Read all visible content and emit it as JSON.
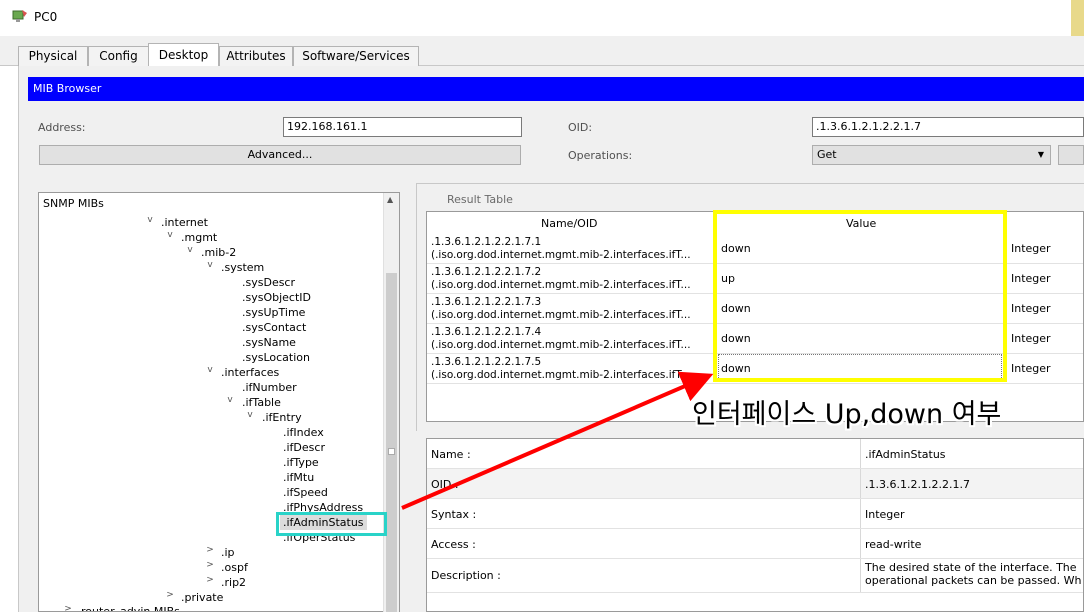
{
  "window": {
    "title": "PC0"
  },
  "tabs": [
    "Physical",
    "Config",
    "Desktop",
    "Attributes",
    "Software/Services"
  ],
  "mib_browser": {
    "title": "MIB Browser",
    "address_label": "Address:",
    "address_value": "192.168.161.1",
    "oid_label": "OID:",
    "oid_value": ".1.3.6.1.2.1.2.2.1.7",
    "advanced_label": "Advanced...",
    "operations_label": "Operations:",
    "operation_value": "Get"
  },
  "tree": {
    "root": "SNMP MIBs",
    "nodes": [
      ".internet",
      ".mgmt",
      ".mib-2",
      ".system",
      ".sysDescr",
      ".sysObjectID",
      ".sysUpTime",
      ".sysContact",
      ".sysName",
      ".sysLocation",
      ".interfaces",
      ".ifNumber",
      ".ifTable",
      ".ifEntry",
      ".ifIndex",
      ".ifDescr",
      ".ifType",
      ".ifMtu",
      ".ifSpeed",
      ".ifPhysAddress",
      ".ifAdminStatus",
      ".ifOperStatus",
      ".ip",
      ".ospf",
      ".rip2",
      ".private",
      "router_advin MIBs"
    ]
  },
  "result": {
    "title": "Result Table",
    "col_name": "Name/OID",
    "col_value": "Value",
    "rows": [
      {
        "oid": ".1.3.6.1.2.1.2.2.1.7.1",
        "path": "(.iso.org.dod.internet.mgmt.mib-2.interfaces.ifT...",
        "value": "down",
        "type": "Integer"
      },
      {
        "oid": ".1.3.6.1.2.1.2.2.1.7.2",
        "path": "(.iso.org.dod.internet.mgmt.mib-2.interfaces.ifT...",
        "value": "up",
        "type": "Integer"
      },
      {
        "oid": ".1.3.6.1.2.1.2.2.1.7.3",
        "path": "(.iso.org.dod.internet.mgmt.mib-2.interfaces.ifT...",
        "value": "down",
        "type": "Integer"
      },
      {
        "oid": ".1.3.6.1.2.1.2.2.1.7.4",
        "path": "(.iso.org.dod.internet.mgmt.mib-2.interfaces.ifT...",
        "value": "down",
        "type": "Integer"
      },
      {
        "oid": ".1.3.6.1.2.1.2.2.1.7.5",
        "path": "(.iso.org.dod.internet.mgmt.mib-2.interfaces.ifT...",
        "value": "down",
        "type": "Integer"
      }
    ]
  },
  "annotation": {
    "text": "인터페이스 Up,down 여부",
    "highlight_color": "#ffff00",
    "tree_highlight_color": "#29d3c8",
    "arrow_color": "#ff0000"
  },
  "details": [
    {
      "key": "Name :",
      "value": ".ifAdminStatus"
    },
    {
      "key": "OID :",
      "value": ".1.3.6.1.2.1.2.2.1.7"
    },
    {
      "key": "Syntax :",
      "value": "Integer"
    },
    {
      "key": "Access :",
      "value": "read-write"
    },
    {
      "key": "Description :",
      "value": "The desired state of the interface. The",
      "value2": "operational packets can be passed. Wh"
    }
  ]
}
